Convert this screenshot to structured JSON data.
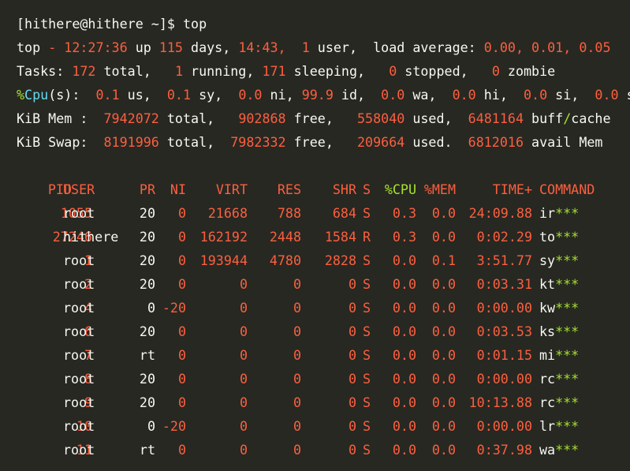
{
  "prompt": {
    "text": "[hithere@hithere ~]$ top"
  },
  "summary": {
    "top_label": "top",
    "time": "12:27:36",
    "up_label": "up",
    "days": "115",
    "days_label": "days,",
    "uptime": "14:43,",
    "users": "1",
    "users_label": "user,",
    "load_label": "load average:",
    "load1": "0.00,",
    "load5": "0.01,",
    "load15": "0.05"
  },
  "tasks": {
    "label": "Tasks:",
    "total": "172",
    "total_label": "total,",
    "running": "1",
    "running_label": "running,",
    "sleeping": "171",
    "sleeping_label": "sleeping,",
    "stopped": "0",
    "stopped_label": "stopped,",
    "zombie": "0",
    "zombie_label": "zombie"
  },
  "cpu": {
    "label_pct": "%",
    "label_cpu": "Cpu",
    "label_s": "(s):",
    "us": "0.1",
    "sy": "0.1",
    "ni": "0.0",
    "id": "99.9",
    "wa": "0.0",
    "hi": "0.0",
    "si": "0.0",
    "st": "0.0"
  },
  "mem": {
    "label": "KiB Mem :",
    "total": "7942072",
    "free": "902868",
    "used": "558040",
    "buff": "6481164",
    "buff_label1": "buff",
    "slash": "/",
    "buff_label2": "cache"
  },
  "swap": {
    "label": "KiB Swap:",
    "total": "8191996",
    "free": "7982332",
    "used": "209664",
    "avail": "6812016",
    "avail_label": "avail Mem"
  },
  "columns": [
    "PID",
    "USER",
    "PR",
    "NI",
    "VIRT",
    "RES",
    "SHR",
    "S",
    "%CPU",
    "%MEM",
    "TIME+",
    "COMMAND"
  ],
  "processes": [
    {
      "pid": "1055",
      "user": "root",
      "pr": "20",
      "ni": "0",
      "virt": "21668",
      "res": "788",
      "shr": "684",
      "s": "S",
      "cpu": "0.3",
      "mem": "0.0",
      "time_a": "24",
      "time_b": ":09.88",
      "cmd": "ir",
      "mask": "***"
    },
    {
      "pid": "27246",
      "user": "hithere",
      "pr": "20",
      "ni": "0",
      "virt": "162192",
      "res": "2448",
      "shr": "1584",
      "s": "R",
      "cpu": "0.3",
      "mem": "0.0",
      "time_a": "0",
      "time_b": ":02.29",
      "cmd": "to",
      "mask": "***"
    },
    {
      "pid": "1",
      "user": "root",
      "pr": "20",
      "ni": "0",
      "virt": "193944",
      "res": "4780",
      "shr": "2828",
      "s": "S",
      "cpu": "0.0",
      "mem": "0.1",
      "time_a": "3",
      "time_b": ":51.77",
      "cmd": "sy",
      "mask": "***"
    },
    {
      "pid": "2",
      "user": "root",
      "pr": "20",
      "ni": "0",
      "virt": "0",
      "res": "0",
      "shr": "0",
      "s": "S",
      "cpu": "0.0",
      "mem": "0.0",
      "time_a": "0",
      "time_b": ":03.31",
      "cmd": "kt",
      "mask": "***"
    },
    {
      "pid": "4",
      "user": "root",
      "pr": "0",
      "ni": "-20",
      "virt": "0",
      "res": "0",
      "shr": "0",
      "s": "S",
      "cpu": "0.0",
      "mem": "0.0",
      "time_a": "0",
      "time_b": ":00.00",
      "cmd": "kw",
      "mask": "***"
    },
    {
      "pid": "6",
      "user": "root",
      "pr": "20",
      "ni": "0",
      "virt": "0",
      "res": "0",
      "shr": "0",
      "s": "S",
      "cpu": "0.0",
      "mem": "0.0",
      "time_a": "0",
      "time_b": ":03.53",
      "cmd": "ks",
      "mask": "***"
    },
    {
      "pid": "7",
      "user": "root",
      "pr": "rt",
      "ni": "0",
      "virt": "0",
      "res": "0",
      "shr": "0",
      "s": "S",
      "cpu": "0.0",
      "mem": "0.0",
      "time_a": "0",
      "time_b": ":01.15",
      "cmd": "mi",
      "mask": "***"
    },
    {
      "pid": "8",
      "user": "root",
      "pr": "20",
      "ni": "0",
      "virt": "0",
      "res": "0",
      "shr": "0",
      "s": "S",
      "cpu": "0.0",
      "mem": "0.0",
      "time_a": "0",
      "time_b": ":00.00",
      "cmd": "rc",
      "mask": "***"
    },
    {
      "pid": "9",
      "user": "root",
      "pr": "20",
      "ni": "0",
      "virt": "0",
      "res": "0",
      "shr": "0",
      "s": "S",
      "cpu": "0.0",
      "mem": "0.0",
      "time_a": "10",
      "time_b": ":13.88",
      "cmd": "rc",
      "mask": "***"
    },
    {
      "pid": "10",
      "user": "root",
      "pr": "0",
      "ni": "-20",
      "virt": "0",
      "res": "0",
      "shr": "0",
      "s": "S",
      "cpu": "0.0",
      "mem": "0.0",
      "time_a": "0",
      "time_b": ":00.00",
      "cmd": "lr",
      "mask": "***"
    },
    {
      "pid": "11",
      "user": "root",
      "pr": "rt",
      "ni": "0",
      "virt": "0",
      "res": "0",
      "shr": "0",
      "s": "S",
      "cpu": "0.0",
      "mem": "0.0",
      "time_a": "0",
      "time_b": ":37.98",
      "cmd": "wa",
      "mask": "***"
    }
  ],
  "colors": {
    "background": "#272822",
    "text": "#f8f8f2",
    "number": "#fd5f3f",
    "green": "#a6e22e",
    "blue": "#66d9ef"
  }
}
